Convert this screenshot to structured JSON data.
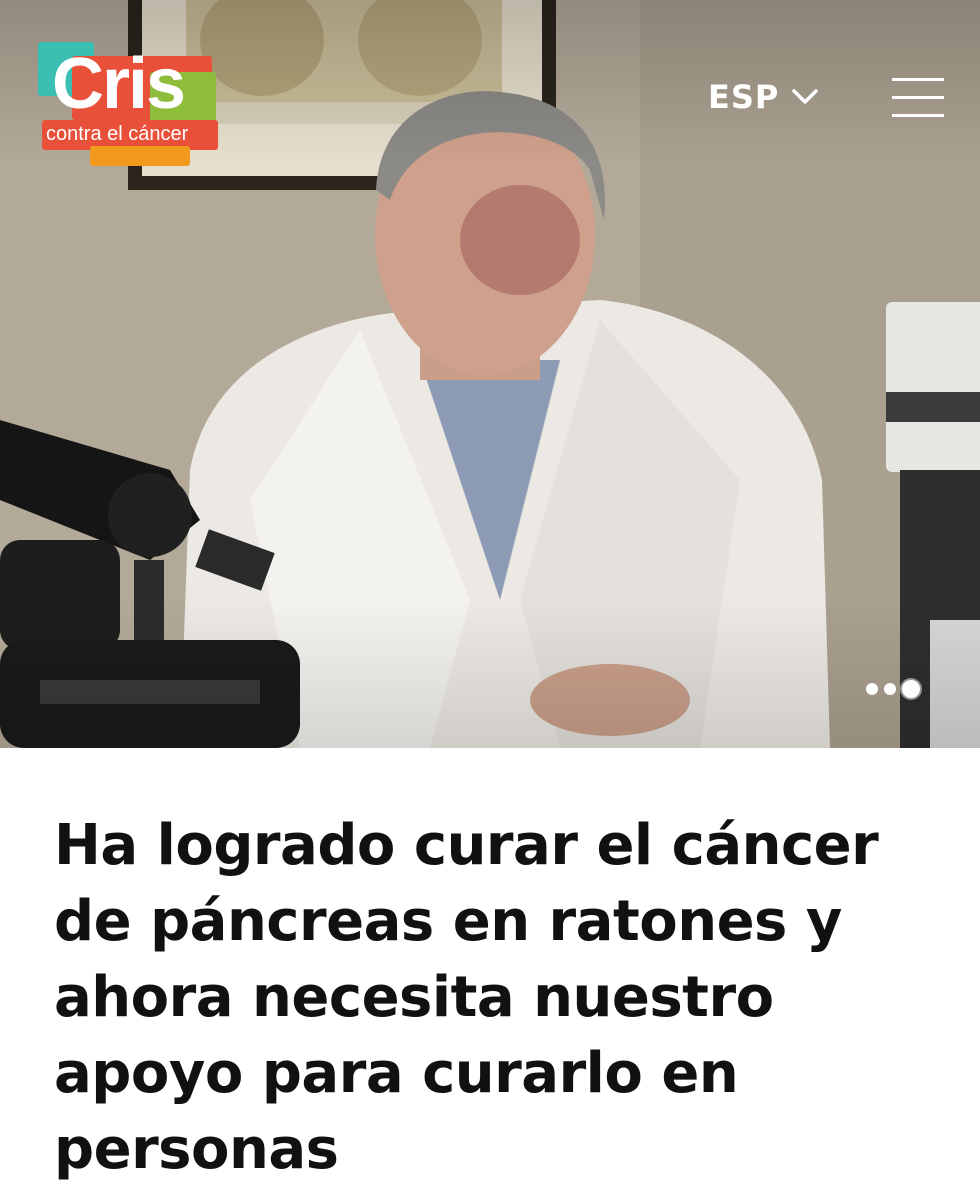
{
  "header": {
    "logo": {
      "word": "Cris",
      "tagline": "contra el cáncer",
      "colors": [
        "#3bbfb3",
        "#e8503a",
        "#8dbd3a",
        "#f29a1c"
      ]
    },
    "language": {
      "label": "ESP",
      "icon": "chevron-down-icon"
    },
    "menu": {
      "icon": "hamburger-menu-icon"
    }
  },
  "hero": {
    "image": "researcher-in-lab-coat-with-microscope",
    "carousel": {
      "total": 3,
      "active": 3
    }
  },
  "article": {
    "headline": "Ha logrado curar el cáncer de páncreas en ratones y ahora necesita nuestro apoyo para curarlo en personas"
  }
}
